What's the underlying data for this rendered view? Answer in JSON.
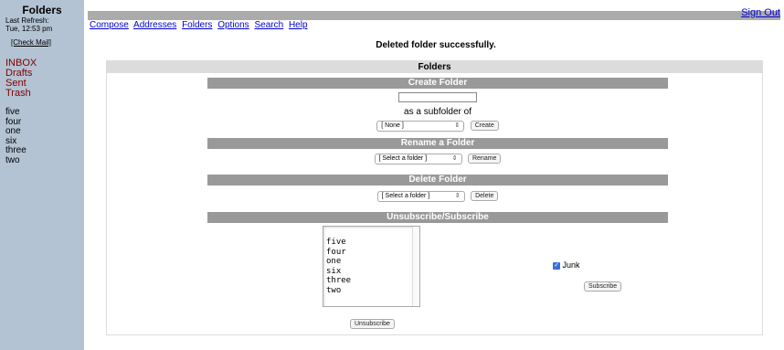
{
  "sidebar": {
    "title": "Folders",
    "last_refresh_label": "Last Refresh:",
    "last_refresh_time": "Tue, 12:53 pm",
    "check_mail": "[Check Mail]",
    "special_folders": [
      "INBOX",
      "Drafts",
      "Sent",
      "Trash"
    ],
    "user_folders": [
      "five",
      "four",
      "one",
      "six",
      "three",
      "two"
    ]
  },
  "header": {
    "sign_out": "Sign Out",
    "menu": [
      "Compose",
      "Addresses",
      "Folders",
      "Options",
      "Search",
      "Help"
    ],
    "status_message": "Deleted folder successfully."
  },
  "panel": {
    "title": "Folders",
    "create": {
      "heading": "Create Folder",
      "input_value": "",
      "subfolder_label": "as a subfolder of",
      "select_value": "[ None ]",
      "button": "Create"
    },
    "rename": {
      "heading": "Rename a Folder",
      "select_value": "[ Select a folder ]",
      "button": "Rename"
    },
    "delete": {
      "heading": "Delete Folder",
      "select_value": "[ Select a folder ]",
      "button": "Delete"
    },
    "subscribe": {
      "heading": "Unsubscribe/Subscribe",
      "subscribed": [
        "five",
        "four",
        "one",
        "six",
        "three",
        "two"
      ],
      "unsubscribe_button": "Unsubscribe",
      "unsubscribed_item": "Junk",
      "unsubscribed_checked": true,
      "subscribe_button": "Subscribe"
    }
  },
  "colors": {
    "sidebar_bg": "#b3c3d3",
    "special_folder": "#800000",
    "link": "#0000cc",
    "section_header": "#999999",
    "checkbox": "#3a6fd6"
  }
}
